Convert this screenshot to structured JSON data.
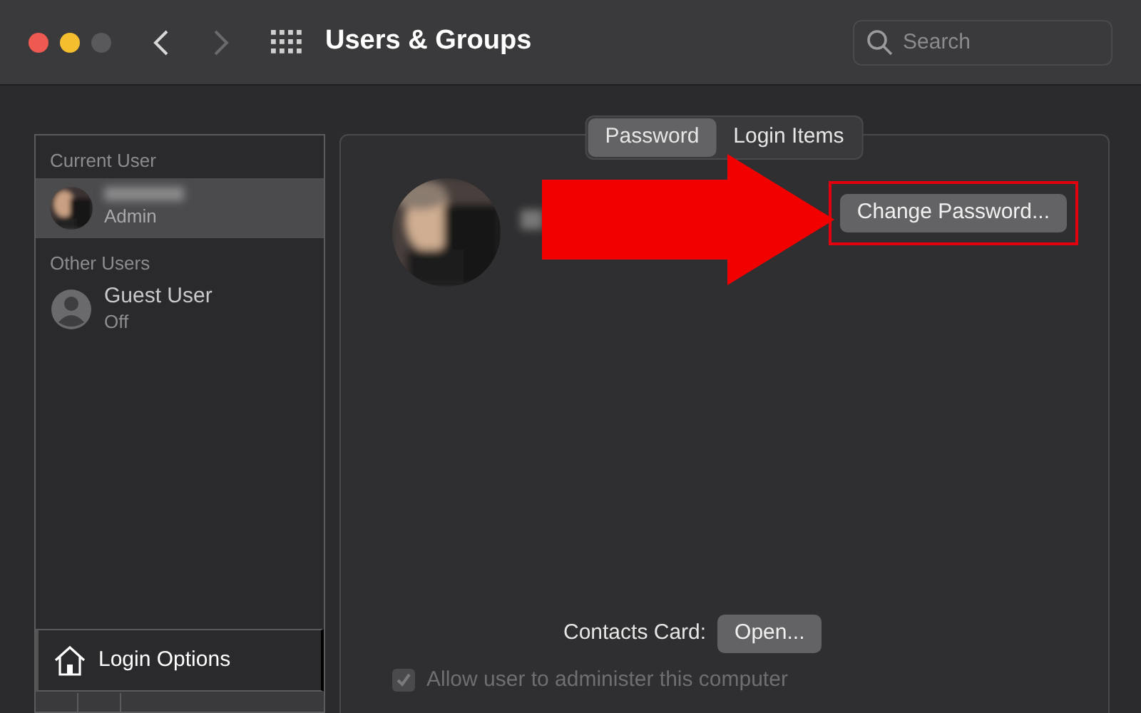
{
  "window": {
    "title": "Users & Groups",
    "back_enabled": true,
    "forward_enabled": false
  },
  "search": {
    "placeholder": "Search"
  },
  "sidebar": {
    "sections": [
      {
        "header": "Current User",
        "users": [
          {
            "role": "Admin",
            "selected": true
          }
        ]
      },
      {
        "header": "Other Users",
        "users": [
          {
            "name": "Guest User",
            "role": "Off",
            "selected": false,
            "kind": "generic"
          }
        ]
      }
    ],
    "login_options": "Login Options"
  },
  "tabs": [
    {
      "label": "Password",
      "selected": true
    },
    {
      "label": "Login Items",
      "selected": false
    }
  ],
  "change_password": {
    "label": "Change Password...",
    "highlighted": true
  },
  "contacts_card": {
    "label": "Contacts Card:",
    "button": "Open..."
  },
  "admin_checkbox": {
    "label": "Allow user to administer this computer",
    "checked": true,
    "disabled": true
  }
}
